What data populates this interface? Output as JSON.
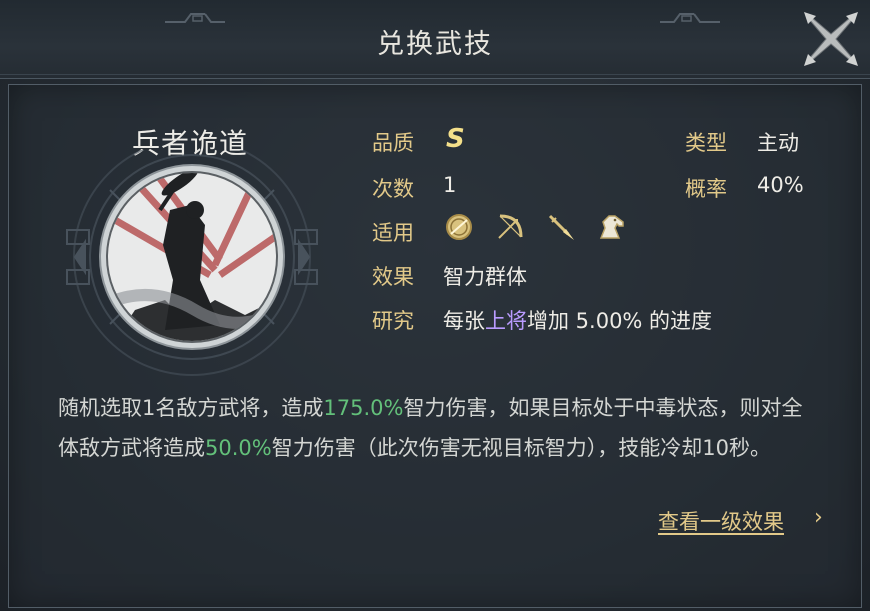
{
  "dialog": {
    "title": "兑换武技",
    "close_icon": "close-icon"
  },
  "skill": {
    "name": "兵者诡道",
    "portrait_icon": "general-silhouette-portrait"
  },
  "attributes": {
    "quality_label": "品质",
    "quality_value": "S",
    "type_label": "类型",
    "type_value": "主动",
    "count_label": "次数",
    "count_value": "1",
    "rate_label": "概率",
    "rate_value": "40%",
    "applicable_label": "适用",
    "applicable_icons": [
      "shield-icon",
      "bow-icon",
      "spear-icon",
      "horse-icon"
    ],
    "effect_label": "效果",
    "effect_value": "智力群体",
    "research_label": "研究",
    "research_prefix": "每张",
    "research_highlight": "上将",
    "research_suffix": "增加 5.00% 的进度"
  },
  "description": {
    "p1": "随机选取1名敌方武将，造成",
    "v1": "175.0%",
    "p2": "智力伤害，如果目标处于中毒状态，则对全体敌方武将造成",
    "v2": "50.0%",
    "p3": "智力伤害（此次伤害无视目标智力），技能冷却10秒。"
  },
  "footer": {
    "link_label": "查看一级效果",
    "chevron": "›"
  },
  "colors": {
    "gold_label": "#e2c989",
    "grade": "#f4e08a",
    "green_value": "#63c07a",
    "purple_value": "#b99bff"
  }
}
